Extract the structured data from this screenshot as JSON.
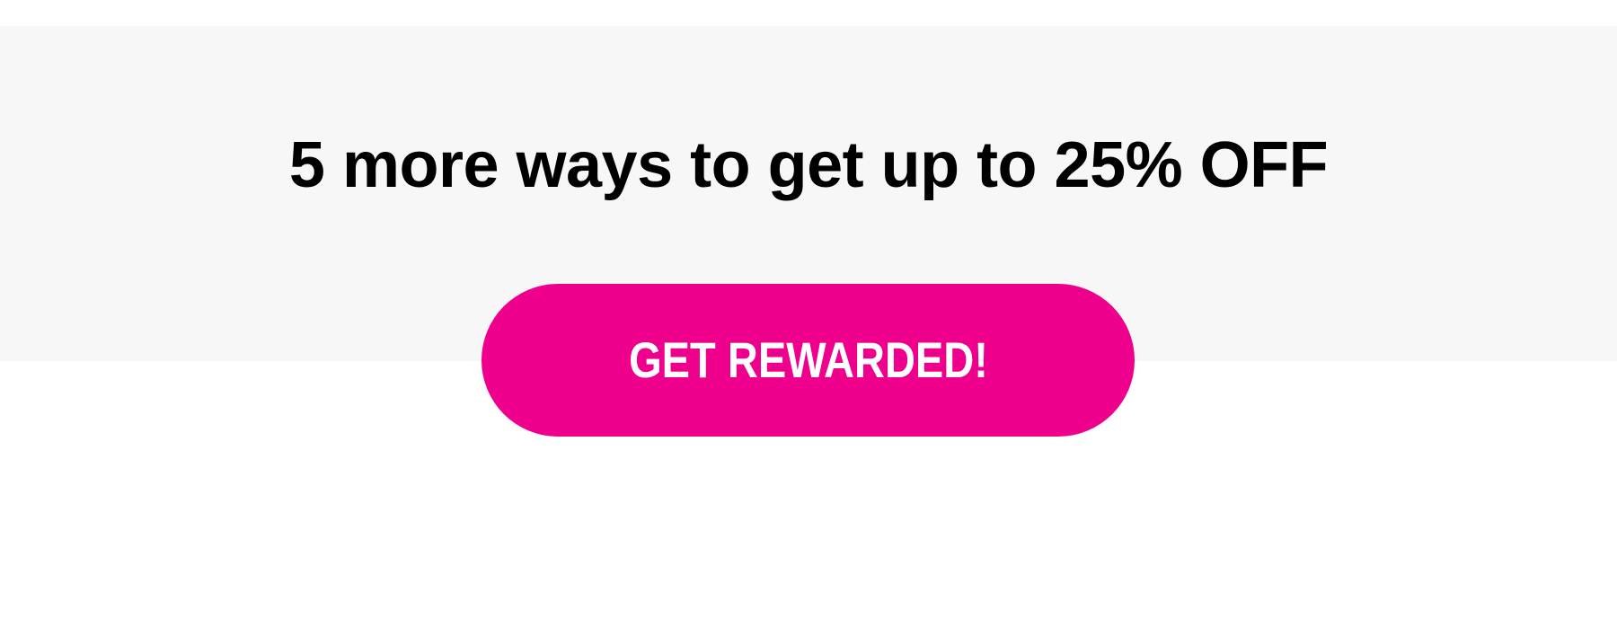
{
  "promo": {
    "headline": "5 more ways to get up to 25% OFF",
    "cta_label": "GET REWARDED!"
  },
  "colors": {
    "band_background": "#f7f7f7",
    "headline_text": "#000000",
    "cta_background": "#ee008c",
    "cta_text": "#ffffff"
  }
}
